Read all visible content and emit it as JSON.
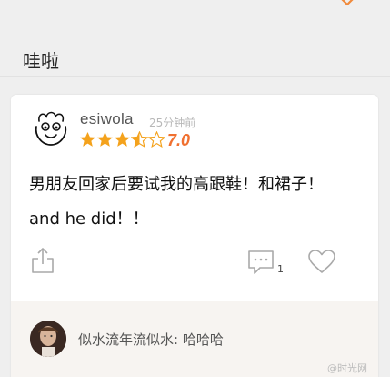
{
  "header": {
    "tab_label": "哇啦",
    "accent_color": "#f08a3c",
    "chevron_icon": "chevron-down-icon"
  },
  "post": {
    "username": "esiwola",
    "time": "25分钟前",
    "rating_stars": 3.5,
    "rating_max": 5,
    "score": "7.0",
    "body_line1": "男朋友回家后要试我的高跟鞋！和裙子！",
    "body_line2": "and he did！！",
    "comment_count": "1",
    "icons": [
      "doodle-avatar-icon",
      "share-icon",
      "comment-icon",
      "heart-icon"
    ]
  },
  "reply": {
    "text": "似水流年流似水: 哈哈哈"
  },
  "watermark": "@时光网"
}
